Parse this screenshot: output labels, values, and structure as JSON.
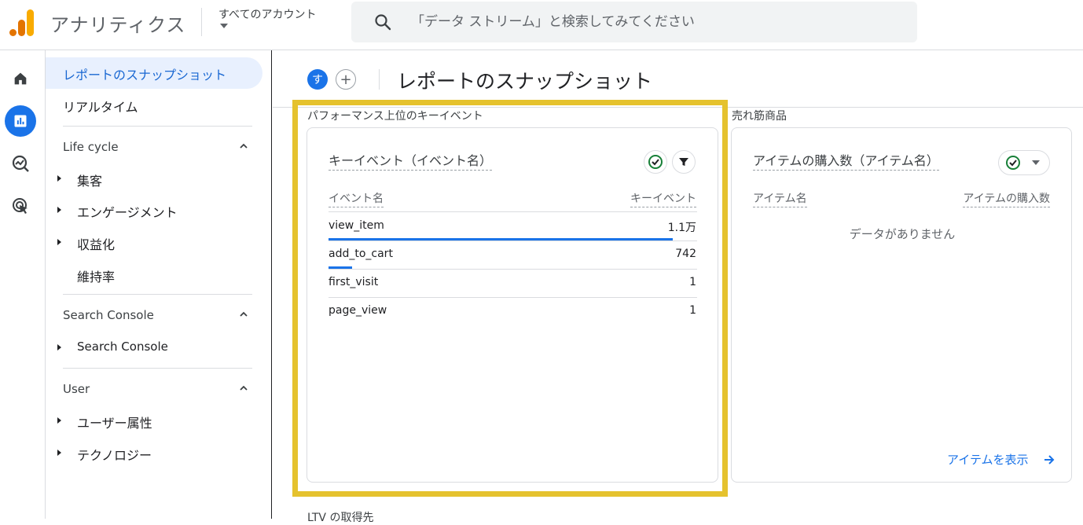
{
  "header": {
    "app_title": "アナリティクス",
    "account_label": "すべてのアカウント",
    "search_placeholder": "「データ ストリーム」と検索してみてください"
  },
  "colors": {
    "brand_blue": "#1a73e8",
    "highlight": "#e5c22e",
    "logo_orange": "#f9ab00",
    "logo_dark_orange": "#e37400"
  },
  "rail": {
    "icons": [
      "home-icon",
      "reports-icon",
      "explore-icon",
      "advertising-icon"
    ],
    "active_index": 1
  },
  "nav": {
    "top_items": [
      "レポートのスナップショット",
      "リアルタイム"
    ],
    "sections": [
      {
        "title": "Life cycle",
        "items": [
          {
            "label": "集客",
            "expandable": true
          },
          {
            "label": "エンゲージメント",
            "expandable": true
          },
          {
            "label": "収益化",
            "expandable": true
          },
          {
            "label": "維持率",
            "expandable": false
          }
        ]
      },
      {
        "title": "Search Console",
        "items": [
          {
            "label": "Search Console",
            "expandable": true
          }
        ]
      },
      {
        "title": "User",
        "items": [
          {
            "label": "ユーザー属性",
            "expandable": true
          },
          {
            "label": "テクノロジー",
            "expandable": true
          }
        ]
      }
    ]
  },
  "content": {
    "avatar_letter": "す",
    "add_label": "+",
    "page_title": "レポートのスナップショット",
    "section1_label": "パフォーマンス上位のキーイベント",
    "section2_label": "売れ筋商品",
    "section3_label": "LTV の取得先",
    "card1": {
      "title": "キーイベント（イベント名）",
      "col_name": "イベント名",
      "col_value": "キーイベント",
      "rows": [
        {
          "name": "view_item",
          "value": "1.1万",
          "bar_fraction": 1.0
        },
        {
          "name": "add_to_cart",
          "value": "742",
          "bar_fraction": 0.068
        },
        {
          "name": "first_visit",
          "value": "1",
          "bar_fraction": 0
        },
        {
          "name": "page_view",
          "value": "1",
          "bar_fraction": 0
        }
      ]
    },
    "card2": {
      "title": "アイテムの購入数（アイテム名）",
      "col_name": "アイテム名",
      "col_value": "アイテムの購入数",
      "empty_text": "データがありません",
      "link_text": "アイテムを表示"
    }
  }
}
